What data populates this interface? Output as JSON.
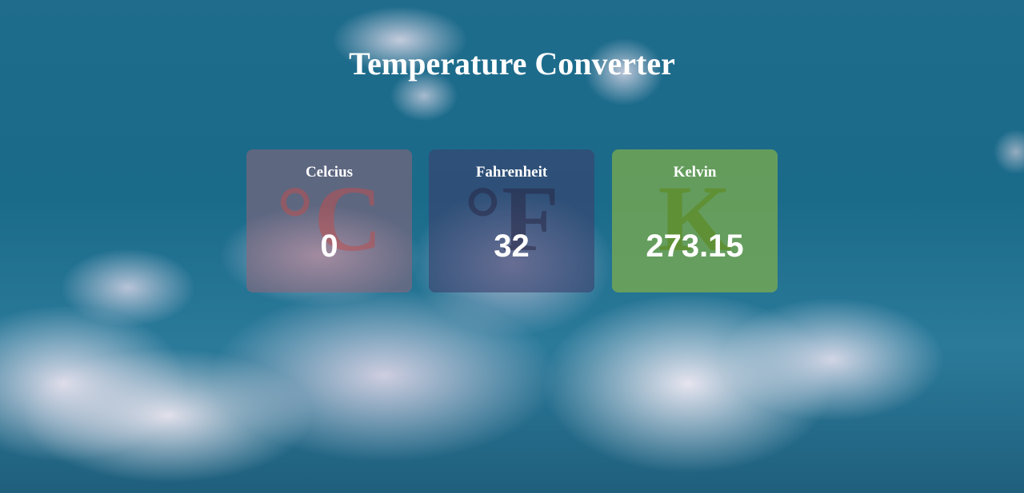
{
  "header": {
    "title": "Temperature Converter"
  },
  "converters": [
    {
      "label": "Celcius",
      "symbol": "°C",
      "value": "0",
      "accent_color": "#b95050"
    },
    {
      "label": "Fahrenheit",
      "symbol": "°F",
      "value": "32",
      "accent_color": "#282846"
    },
    {
      "label": "Kelvin",
      "symbol": "K",
      "value": "273.15",
      "accent_color": "#5f8c28"
    }
  ],
  "background": {
    "description_colors": [
      "#1f6c8c",
      "#e8e4f0"
    ]
  }
}
